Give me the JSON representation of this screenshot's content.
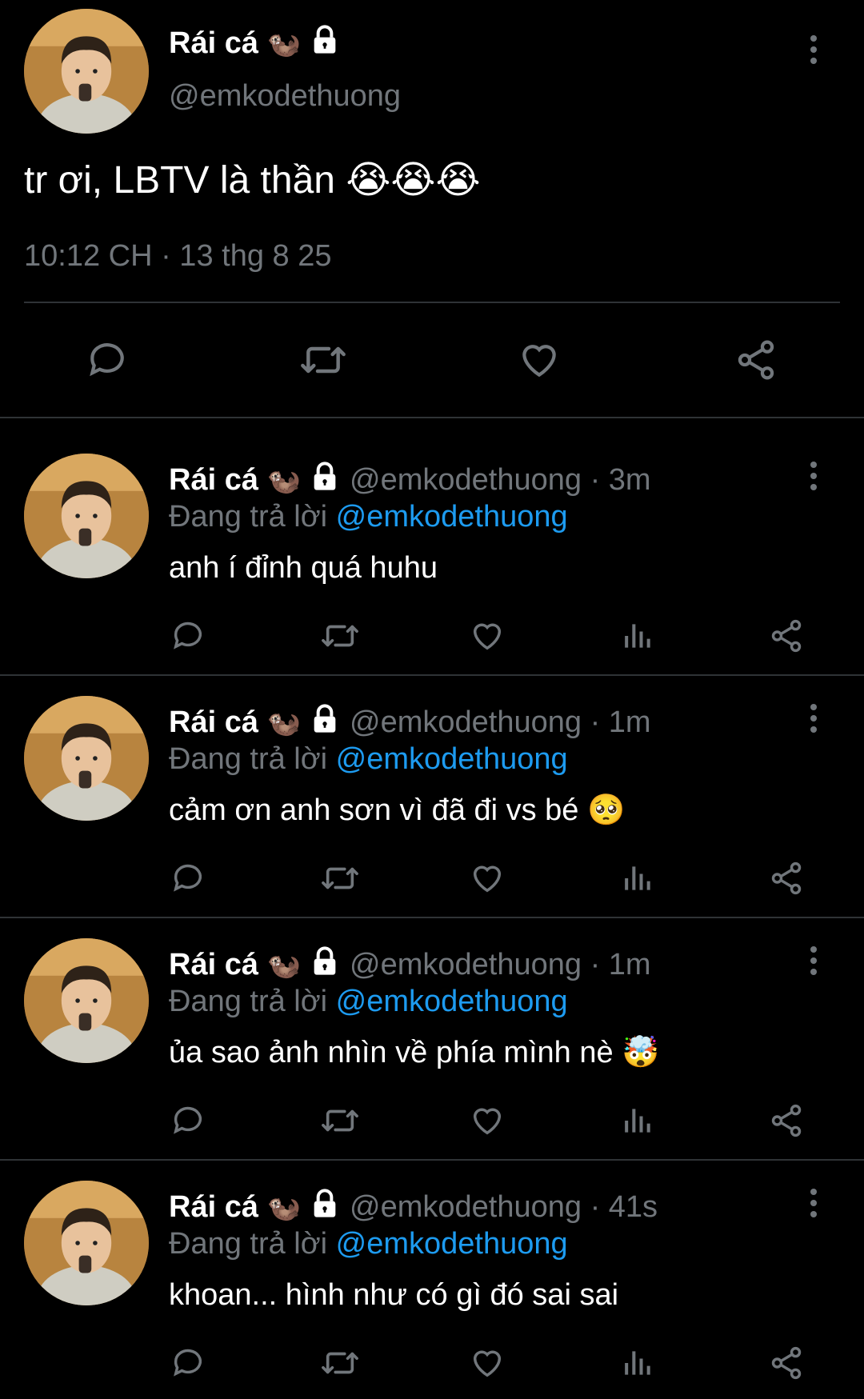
{
  "main_tweet": {
    "display_name": "Rái cá",
    "handle": "@emkodethuong",
    "text": "tr ơi, LBTV là thần",
    "text_emojis": "😭😭😭",
    "timestamp": "10:12 CH · 13 thg 8 25",
    "name_emoji": "🦦",
    "lock_icon": "lock-icon"
  },
  "replies": [
    {
      "display_name": "Rái cá",
      "handle": "@emkodethuong",
      "time": "· 3m",
      "reply_prefix": "Đang trả lời",
      "reply_to": "@emkodethuong",
      "text": "anh í đỉnh quá huhu",
      "emoji": ""
    },
    {
      "display_name": "Rái cá",
      "handle": "@emkodethuong",
      "time": "· 1m",
      "reply_prefix": "Đang trả lời",
      "reply_to": "@emkodethuong",
      "text": "cảm ơn anh sơn vì đã đi vs bé",
      "emoji": "🥺"
    },
    {
      "display_name": "Rái cá",
      "handle": "@emkodethuong",
      "time": "· 1m",
      "reply_prefix": "Đang trả lời",
      "reply_to": "@emkodethuong",
      "text": "ủa sao ảnh nhìn về phía mình nè",
      "emoji": "🤯"
    },
    {
      "display_name": "Rái cá",
      "handle": "@emkodethuong",
      "time": "· 41s",
      "reply_prefix": "Đang trả lời",
      "reply_to": "@emkodethuong",
      "text": "khoan... hình như có gì đó sai sai",
      "emoji": ""
    }
  ],
  "colors": {
    "background": "#000000",
    "text": "#e7e9ea",
    "muted": "#71767b",
    "link": "#1d9bf0",
    "divider": "#2f3336"
  }
}
